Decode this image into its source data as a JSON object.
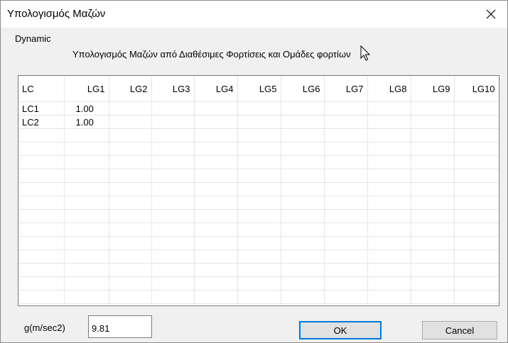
{
  "window": {
    "title": "Υπολογισμός Μαζών"
  },
  "section": {
    "label": "Dynamic",
    "subtitle": "Υπολογισμός Μαζών από Διαθέσιμες Φορτίσεις και Ομάδες φορτίων"
  },
  "grid": {
    "columns": [
      "LC",
      "LG1",
      "LG2",
      "LG3",
      "LG4",
      "LG5",
      "LG6",
      "LG7",
      "LG8",
      "LG9",
      "LG10"
    ],
    "rows": [
      [
        "LC1",
        "1.00",
        "",
        "",
        "",
        "",
        "",
        "",
        "",
        "",
        ""
      ],
      [
        "LC2",
        "1.00",
        "",
        "",
        "",
        "",
        "",
        "",
        "",
        "",
        ""
      ],
      [
        "",
        "",
        "",
        "",
        "",
        "",
        "",
        "",
        "",
        "",
        ""
      ],
      [
        "",
        "",
        "",
        "",
        "",
        "",
        "",
        "",
        "",
        "",
        ""
      ],
      [
        "",
        "",
        "",
        "",
        "",
        "",
        "",
        "",
        "",
        "",
        ""
      ],
      [
        "",
        "",
        "",
        "",
        "",
        "",
        "",
        "",
        "",
        "",
        ""
      ],
      [
        "",
        "",
        "",
        "",
        "",
        "",
        "",
        "",
        "",
        "",
        ""
      ],
      [
        "",
        "",
        "",
        "",
        "",
        "",
        "",
        "",
        "",
        "",
        ""
      ],
      [
        "",
        "",
        "",
        "",
        "",
        "",
        "",
        "",
        "",
        "",
        ""
      ],
      [
        "",
        "",
        "",
        "",
        "",
        "",
        "",
        "",
        "",
        "",
        ""
      ],
      [
        "",
        "",
        "",
        "",
        "",
        "",
        "",
        "",
        "",
        "",
        ""
      ],
      [
        "",
        "",
        "",
        "",
        "",
        "",
        "",
        "",
        "",
        "",
        ""
      ],
      [
        "",
        "",
        "",
        "",
        "",
        "",
        "",
        "",
        "",
        "",
        ""
      ],
      [
        "",
        "",
        "",
        "",
        "",
        "",
        "",
        "",
        "",
        "",
        ""
      ],
      [
        "",
        "",
        "",
        "",
        "",
        "",
        "",
        "",
        "",
        "",
        ""
      ]
    ]
  },
  "gravity": {
    "label": "g(m/sec2)",
    "value": "9.81"
  },
  "buttons": {
    "ok": "OK",
    "cancel": "Cancel"
  },
  "icons": {
    "close": "close-icon",
    "cursor": "mouse-pointer-icon"
  }
}
